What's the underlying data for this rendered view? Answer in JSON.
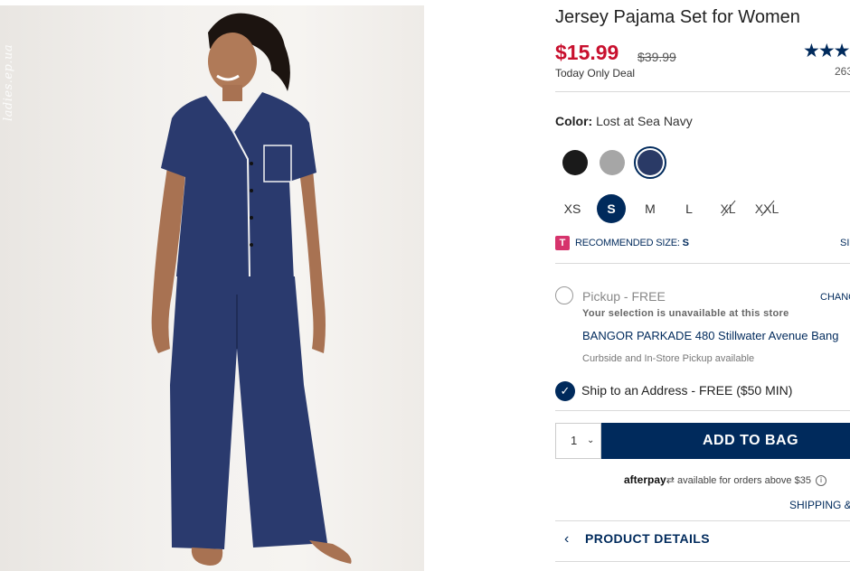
{
  "image": {
    "watermark": "ladies.ep.ua"
  },
  "product": {
    "title": "Jersey Pajama Set for Women",
    "price": "$15.99",
    "original_price": "$39.99",
    "deal_label": "Today Only Deal",
    "rating_stars": "★★★",
    "review_count": "263"
  },
  "color": {
    "label": "Color:",
    "selected_name": "Lost at Sea Navy",
    "swatches": [
      {
        "name": "black",
        "hex": "#1a1a1a"
      },
      {
        "name": "heather-gray",
        "hex": "#a6a6a6"
      },
      {
        "name": "lost-at-sea-navy",
        "hex": "#2a3a66",
        "selected": true
      }
    ]
  },
  "sizes": [
    {
      "label": "XS",
      "state": "available"
    },
    {
      "label": "S",
      "state": "selected"
    },
    {
      "label": "M",
      "state": "available"
    },
    {
      "label": "L",
      "state": "available"
    },
    {
      "label": "XL",
      "state": "unavailable"
    },
    {
      "label": "XXL",
      "state": "unavailable"
    }
  ],
  "recommended": {
    "badge": "T",
    "text": "RECOMMENDED SIZE:",
    "size": "S",
    "size_chart_link": "SI"
  },
  "fulfillment": {
    "pickup_label": "Pickup - FREE",
    "change_link": "CHANG",
    "unavailable_note": "Your selection is unavailable at this store",
    "store_line": "BANGOR PARKADE 480 Stillwater Avenue  Bang",
    "curbside_note": "Curbside and In-Store Pickup available",
    "ship_label": "Ship to an Address - FREE ($50 MIN)"
  },
  "purchase": {
    "quantity": "1",
    "add_to_bag_label": "ADD TO BAG",
    "afterpay_brand": "afterpay",
    "afterpay_text": "available for orders above $35",
    "shipping_link": "SHIPPING &"
  },
  "details": {
    "label": "PRODUCT DETAILS"
  },
  "colors": {
    "brand_navy": "#002a5c",
    "sale_red": "#c8102e",
    "pajama_navy": "#2a3a6e"
  }
}
